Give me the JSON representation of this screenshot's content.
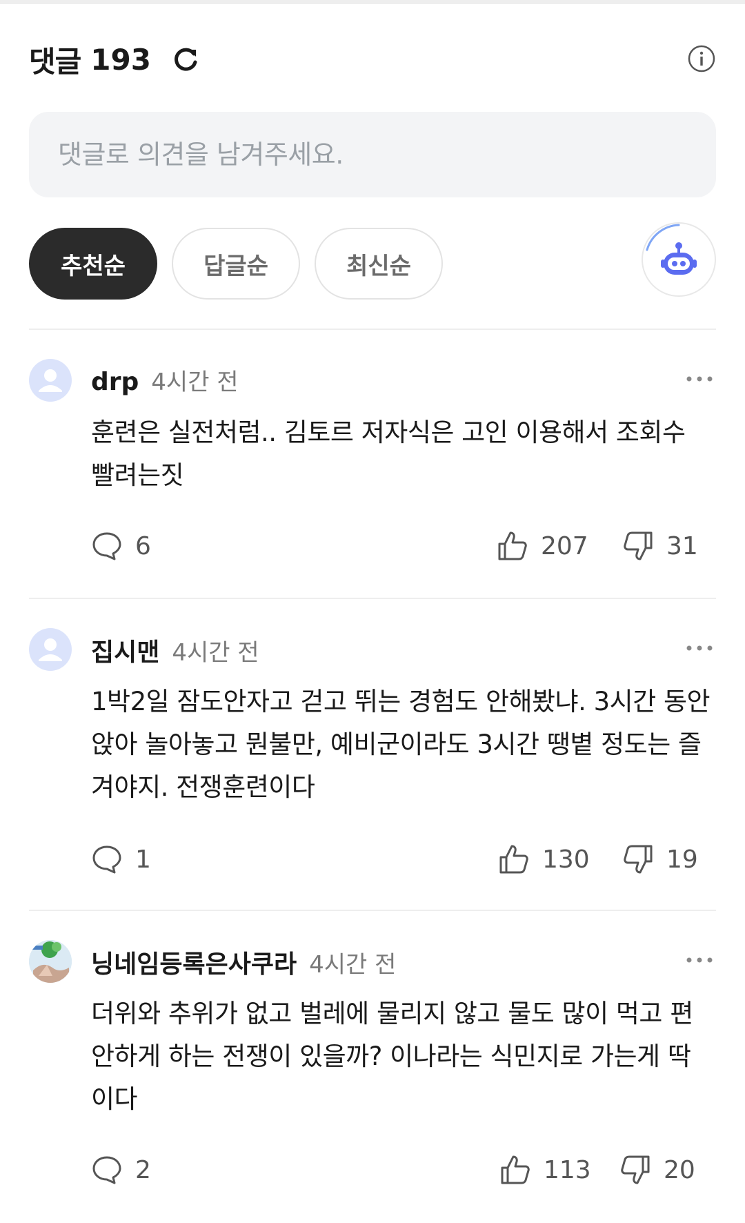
{
  "header": {
    "title": "댓글",
    "count": "193"
  },
  "input": {
    "placeholder": "댓글로 의견을 남겨주세요."
  },
  "sort": {
    "options": [
      "추천순",
      "답글순",
      "최신순"
    ],
    "active": "추천순"
  },
  "comments": [
    {
      "author": "drp",
      "time": "4시간 전",
      "text": "훈련은 실전처럼.. 김토르 저자식은 고인 이용해서 조회수 빨려는짓",
      "replies": "6",
      "likes": "207",
      "dislikes": "31"
    },
    {
      "author": "집시맨",
      "time": "4시간 전",
      "text": "1박2일 잠도안자고 걷고 뛰는 경험도 안해봤냐. 3시간 동안 앉아 놀아놓고 뭔불만, 예비군이라도 3시간 땡볕 정도는 즐겨야지. 전쟁훈련이다",
      "replies": "1",
      "likes": "130",
      "dislikes": "19"
    },
    {
      "author": "닝네임등록은사쿠라",
      "time": "4시간 전",
      "text": "더위와 추위가 없고 벌레에 물리지 않고 물도 많이 먹고 편안하게 하는 전쟁이 있을까? 이나라는 식민지로 가는게 딱이다",
      "replies": "2",
      "likes": "113",
      "dislikes": "20"
    }
  ],
  "icons": {
    "refresh": "refresh-icon",
    "info": "info-icon",
    "bot": "bot-icon",
    "more": "more-icon",
    "reply": "speech-bubble-icon",
    "like": "thumbs-up-icon",
    "dislike": "thumbs-down-icon"
  },
  "colors": {
    "active_pill": "#2b2b2b",
    "bot_accent": "#5b6cf0"
  }
}
